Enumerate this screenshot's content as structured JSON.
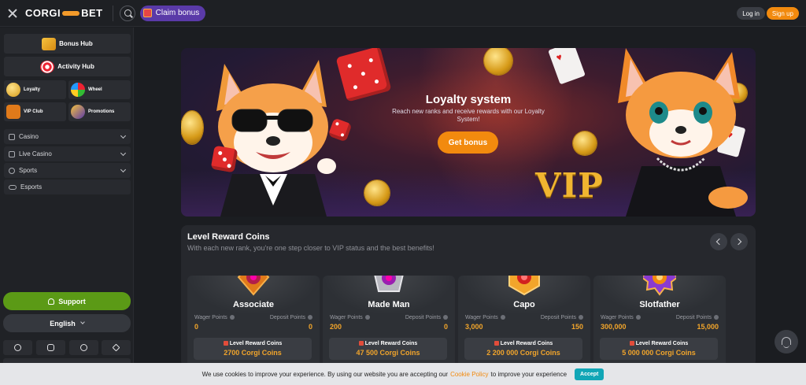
{
  "header": {
    "logo_left": "CORGI",
    "logo_right": "BET",
    "claim_bonus": "Claim bonus",
    "login": "Log in",
    "signup": "Sign up"
  },
  "sidebar": {
    "bonus_hub": "Bonus Hub",
    "activity_hub": "Activity Hub",
    "tiles": [
      "Loyalty",
      "Wheel",
      "VIP Club",
      "Promotions"
    ],
    "nav": [
      {
        "label": "Casino",
        "expandable": true
      },
      {
        "label": "Live Casino",
        "expandable": true
      },
      {
        "label": "Sports",
        "expandable": true
      },
      {
        "label": "Esports",
        "expandable": false
      }
    ],
    "support": "Support",
    "language": "English",
    "socials": [
      "x-icon",
      "instagram-icon",
      "facebook-icon",
      "telegram-icon"
    ]
  },
  "banner": {
    "title": "Loyalty system",
    "subtitle": "Reach new ranks and receive rewards with our Loyalty System!",
    "button": "Get bonus",
    "vip": "VIP"
  },
  "rewards": {
    "title": "Level Reward Coins",
    "subtitle": "With each new rank, you're one step closer to VIP status and the best benefits!",
    "wager_label": "Wager Points",
    "deposit_label": "Deposit Points",
    "coins_label": "Level Reward Coins",
    "ranks": [
      {
        "name": "Associate",
        "wager": "0",
        "deposit": "0",
        "coins": "2700 Corgi Coins",
        "color": "#e07a1a"
      },
      {
        "name": "Made Man",
        "wager": "200",
        "deposit": "0",
        "coins": "47 500 Corgi Coins",
        "color": "#b8b8c0"
      },
      {
        "name": "Capo",
        "wager": "3,000",
        "deposit": "150",
        "coins": "2 200 000 Corgi Coins",
        "color": "#f2a52b"
      },
      {
        "name": "Slotfather",
        "wager": "300,000",
        "deposit": "15,000",
        "coins": "5 000 000 Corgi Coins",
        "color": "#8a3ad0"
      }
    ]
  },
  "cookie": {
    "text_before": "We use cookies to improve your experience. By using our website you are accepting our",
    "link": "Cookie Policy",
    "text_after": "to improve your experience",
    "accept": "Accept"
  },
  "colors": {
    "accent": "#f28a0e",
    "support": "#5b9a16",
    "claim": "#5a3aa8",
    "value": "#f2a52b"
  }
}
